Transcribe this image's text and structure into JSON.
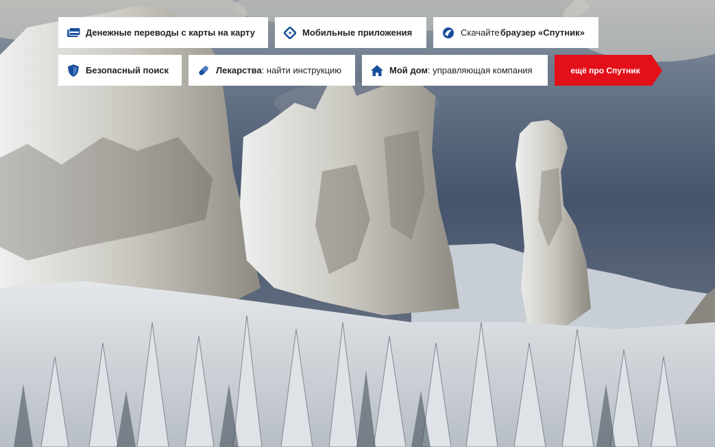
{
  "links": {
    "transfers": {
      "label": "Денежные переводы с карты на карту",
      "icon": "card-icon"
    },
    "apps": {
      "label": "Мобильные приложения",
      "icon": "mobile-apps-icon"
    },
    "browser": {
      "prefix": "Скачайте ",
      "bold": "браузер «Спутник»",
      "icon": "sputnik-browser-icon"
    },
    "safe_search": {
      "label": "Безопасный поиск",
      "icon": "shield-icon"
    },
    "medicine": {
      "bold": "Лекарства",
      "rest": ": найти инструкцию",
      "icon": "pill-icon"
    },
    "home": {
      "bold": "Мой дом",
      "rest": ": управляющая компания",
      "icon": "house-icon"
    }
  },
  "more_button": {
    "label": "ещё про Спутник"
  },
  "colors": {
    "accent_red": "#e3101a",
    "icon_blue": "#1a4f9c",
    "tile_bg": "#ffffff"
  }
}
